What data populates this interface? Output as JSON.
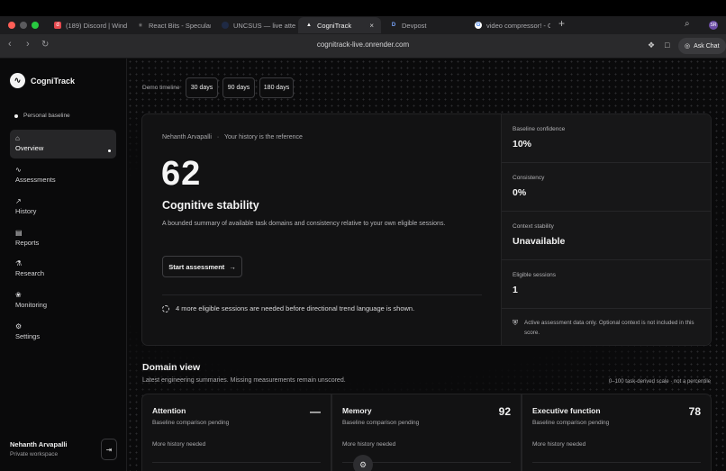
{
  "browser": {
    "tabs": [
      {
        "label": "(189) Discord | Wind F",
        "icon": "discord-icon"
      },
      {
        "label": "React Bits - Specular",
        "icon": "react-icon"
      },
      {
        "label": "UNCSUS — live attend",
        "icon": "dot-icon"
      },
      {
        "label": "CogniTrack",
        "icon": "triangle-icon",
        "active": true
      },
      {
        "label": "Devpost",
        "icon": "d-icon"
      },
      {
        "label": "video compressor! - G",
        "icon": "google-icon"
      }
    ],
    "url": "cognitrack-live.onrender.com",
    "ask_chat": "Ask Chat",
    "profile_initials": "SR"
  },
  "sidebar": {
    "logo_mark": "∿",
    "app_name": "CogniTrack",
    "baseline_label": "Personal baseline",
    "items": [
      {
        "label": "Overview",
        "icon": "home-icon",
        "glyph": "⌂",
        "active": true
      },
      {
        "label": "Assessments",
        "icon": "activity-icon",
        "glyph": "∿"
      },
      {
        "label": "History",
        "icon": "chart-icon",
        "glyph": "↗"
      },
      {
        "label": "Reports",
        "icon": "document-icon",
        "glyph": "▤"
      },
      {
        "label": "Research",
        "icon": "flask-icon",
        "glyph": "⚗"
      },
      {
        "label": "Monitoring",
        "icon": "brain-icon",
        "glyph": "❀"
      },
      {
        "label": "Settings",
        "icon": "gear-icon",
        "glyph": "⚙"
      }
    ],
    "user_name": "Nehanth Arvapalli",
    "workspace": "Private workspace"
  },
  "timeline": {
    "label": "Demo timeline",
    "options": [
      "30 days",
      "90 days",
      "180 days"
    ]
  },
  "hero": {
    "owner": "Nehanth Arvapalli",
    "separator": "·",
    "reference": "Your history is the reference",
    "score": "62",
    "title": "Cognitive stability",
    "description": "A bounded summary of available task domains and consistency relative to your own eligible sessions.",
    "start_button": "Start assessment",
    "note": "4 more eligible sessions are needed before directional trend language is shown."
  },
  "metrics": [
    {
      "label": "Baseline confidence",
      "value": "10%"
    },
    {
      "label": "Consistency",
      "value": "0%"
    },
    {
      "label": "Context stability",
      "value": "Unavailable"
    },
    {
      "label": "Eligible sessions",
      "value": "1"
    }
  ],
  "metrics_footnote": "Active assessment data only. Optional context is not included in this score.",
  "domain_view": {
    "title": "Domain view",
    "subtitle": "Latest engineering summaries. Missing measurements remain unscored.",
    "scale_note": "0–100 task-derived scale · not a percentile",
    "cards": [
      {
        "name": "Attention",
        "value": "—",
        "status": "Baseline comparison pending",
        "history": "More history needed"
      },
      {
        "name": "Memory",
        "value": "92",
        "status": "Baseline comparison pending",
        "history": "More history needed"
      },
      {
        "name": "Executive function",
        "value": "78",
        "status": "Baseline comparison pending",
        "history": "More history needed"
      }
    ]
  }
}
